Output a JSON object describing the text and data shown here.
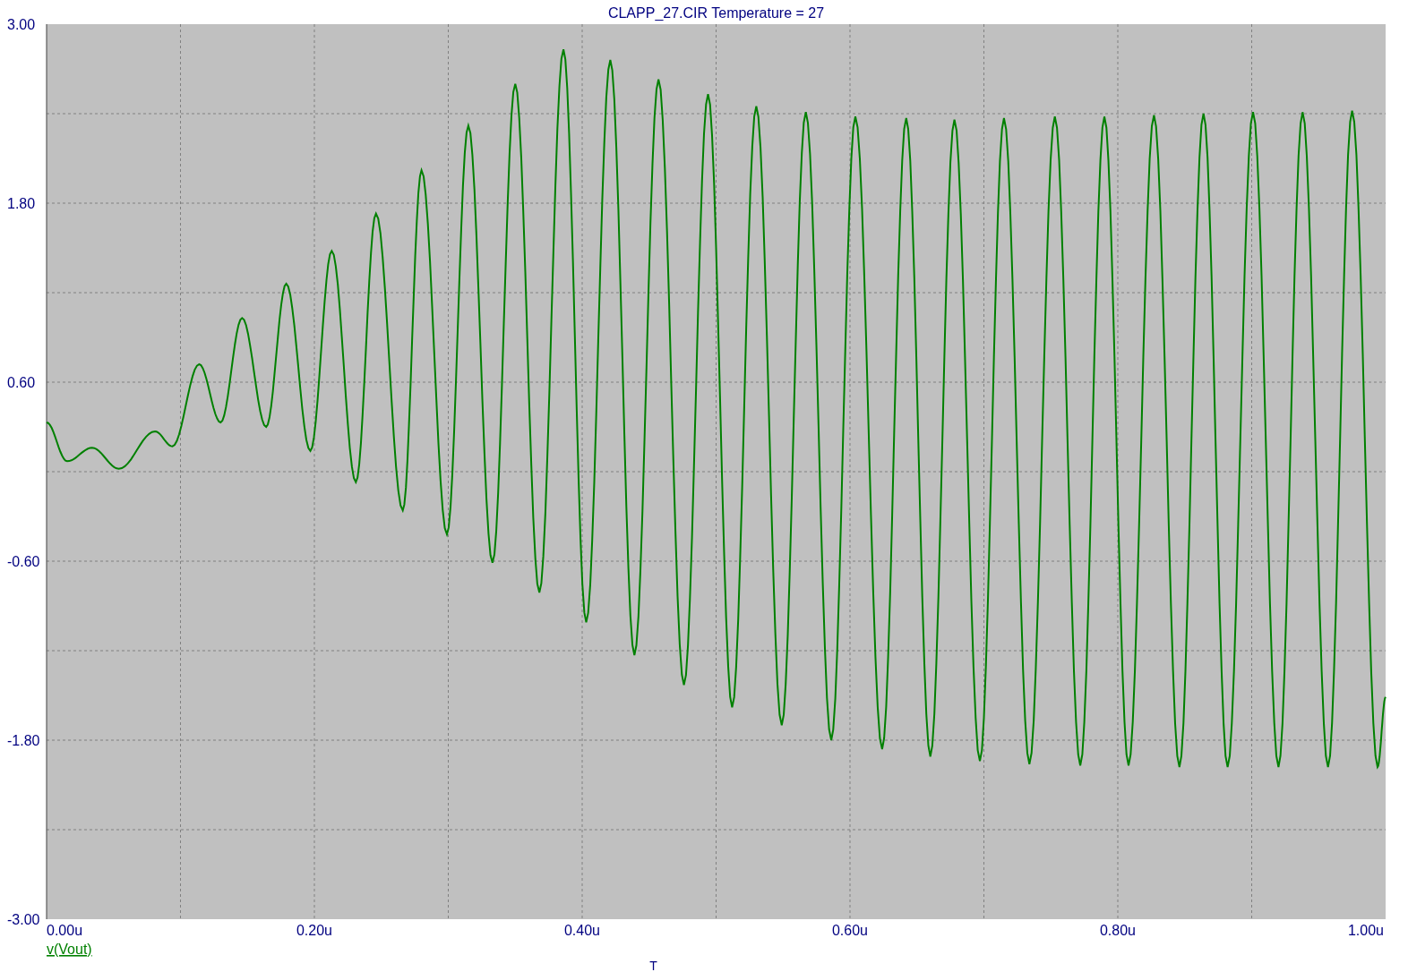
{
  "chart_data": {
    "type": "line",
    "title": "CLAPP_27.CIR Temperature = 27",
    "xlabel": "T",
    "x": [
      0,
      0.0154,
      0.034,
      0.054,
      0.081,
      0.094,
      0.114,
      0.13,
      0.146,
      0.164,
      0.179,
      0.197,
      0.213,
      0.231,
      0.246,
      0.266,
      0.28,
      0.299,
      0.315,
      0.333,
      0.35,
      0.368,
      0.386,
      0.403,
      0.421,
      0.439,
      0.457,
      0.476,
      0.494,
      0.512,
      0.53,
      0.549,
      0.567,
      0.586,
      0.604,
      0.624,
      0.642,
      0.66,
      0.678,
      0.697,
      0.715,
      0.734,
      0.753,
      0.772,
      0.79,
      0.808,
      0.827,
      0.846,
      0.864,
      0.882,
      0.901,
      0.92,
      0.938,
      0.957,
      0.975,
      0.994,
      1.0
    ],
    "series": [
      {
        "name": "v(Vout)",
        "color": "#008000",
        "values": [
          0.33,
          0.07,
          0.16,
          0.02,
          0.27,
          0.17,
          0.72,
          0.33,
          1.03,
          0.3,
          1.26,
          0.14,
          1.48,
          -0.07,
          1.73,
          -0.26,
          2.02,
          -0.42,
          2.32,
          -0.61,
          2.6,
          -0.81,
          2.83,
          -1.01,
          2.76,
          -1.23,
          2.63,
          -1.43,
          2.53,
          -1.58,
          2.45,
          -1.7,
          2.41,
          -1.8,
          2.38,
          -1.86,
          2.37,
          -1.91,
          2.36,
          -1.94,
          2.37,
          -1.96,
          2.38,
          -1.97,
          2.38,
          -1.97,
          2.39,
          -1.98,
          2.4,
          -1.98,
          2.41,
          -1.98,
          2.41,
          -1.98,
          2.42,
          -1.98,
          -1.51
        ]
      }
    ],
    "grid": true,
    "xlim": [
      0,
      1
    ],
    "ylim": [
      -3,
      3
    ],
    "xticks": [
      {
        "value": 0,
        "label": "0.00u"
      },
      {
        "value": 0.2,
        "label": "0.20u"
      },
      {
        "value": 0.4,
        "label": "0.40u"
      },
      {
        "value": 0.6,
        "label": "0.60u"
      },
      {
        "value": 0.8,
        "label": "0.80u"
      },
      {
        "value": 1,
        "label": "1.00u"
      }
    ],
    "yticks": [
      {
        "value": -3,
        "label": "-3.00"
      },
      {
        "value": -1.8,
        "label": "-1.80"
      },
      {
        "value": -0.6,
        "label": "-0.60"
      },
      {
        "value": 0.6,
        "label": "0.60"
      },
      {
        "value": 1.8,
        "label": "1.80"
      },
      {
        "value": 3,
        "label": "3.00"
      }
    ]
  }
}
